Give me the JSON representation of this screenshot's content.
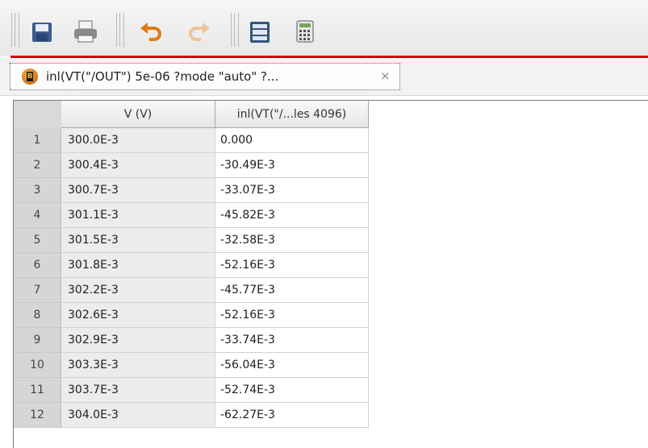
{
  "toolbar": {
    "buttons": [
      {
        "icon": "save-icon"
      },
      {
        "icon": "print-icon"
      },
      {
        "icon": "undo-icon"
      },
      {
        "icon": "redo-icon"
      },
      {
        "icon": "table-layout-icon"
      },
      {
        "icon": "calculator-icon"
      }
    ],
    "accent_color": "#d40000"
  },
  "tab": {
    "label": "inl(VT(\"/OUT\") 5e-06 ?mode \"auto\" ?...",
    "close_symbol": "×",
    "icon_letter": "B"
  },
  "table": {
    "columns": [
      "V (V)",
      "inl(VT(\"/...les 4096)"
    ],
    "rows": [
      {
        "n": "1",
        "v": "300.0E-3",
        "inl": "0.000"
      },
      {
        "n": "2",
        "v": "300.4E-3",
        "inl": "-30.49E-3"
      },
      {
        "n": "3",
        "v": "300.7E-3",
        "inl": "-33.07E-3"
      },
      {
        "n": "4",
        "v": "301.1E-3",
        "inl": "-45.82E-3"
      },
      {
        "n": "5",
        "v": "301.5E-3",
        "inl": "-32.58E-3"
      },
      {
        "n": "6",
        "v": "301.8E-3",
        "inl": "-52.16E-3"
      },
      {
        "n": "7",
        "v": "302.2E-3",
        "inl": "-45.77E-3"
      },
      {
        "n": "8",
        "v": "302.6E-3",
        "inl": "-52.16E-3"
      },
      {
        "n": "9",
        "v": "302.9E-3",
        "inl": "-33.74E-3"
      },
      {
        "n": "10",
        "v": "303.3E-3",
        "inl": "-56.04E-3"
      },
      {
        "n": "11",
        "v": "303.7E-3",
        "inl": "-52.74E-3"
      },
      {
        "n": "12",
        "v": "304.0E-3",
        "inl": "-62.27E-3"
      }
    ]
  }
}
